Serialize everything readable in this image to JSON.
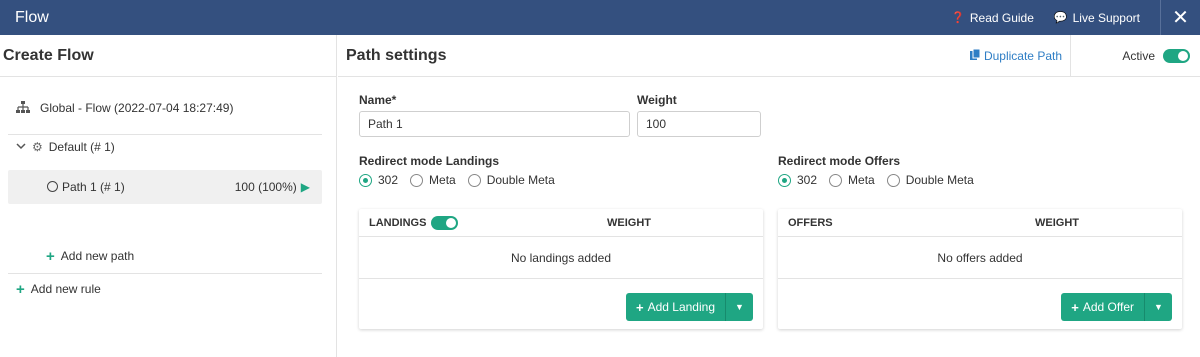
{
  "topbar": {
    "title": "Flow",
    "read_guide": "Read Guide",
    "live_support": "Live Support",
    "close": "✕"
  },
  "left": {
    "title": "Create Flow",
    "global": "Global - Flow (2022-07-04 18:27:49)",
    "default_rule": "Default (# 1)",
    "path_label": "Path 1 (# 1)",
    "path_value": "100 (100%)",
    "add_path": "Add new path",
    "add_rule": "Add new rule"
  },
  "main": {
    "title": "Path settings",
    "duplicate": "Duplicate Path",
    "active_label": "Active",
    "active": true,
    "name_label": "Name*",
    "name_value": "Path 1",
    "weight_label": "Weight",
    "weight_value": "100",
    "redirect_landings_label": "Redirect mode Landings",
    "redirect_offers_label": "Redirect mode Offers",
    "redirect_options": [
      "302",
      "Meta",
      "Double Meta"
    ],
    "redirect_landings_selected": "302",
    "redirect_offers_selected": "302",
    "landings": {
      "header": "LANDINGS",
      "weight_header": "WEIGHT",
      "empty": "No landings added",
      "add_button": "Add Landing",
      "enabled": true
    },
    "offers": {
      "header": "OFFERS",
      "weight_header": "WEIGHT",
      "empty": "No offers added",
      "add_button": "Add Offer"
    }
  },
  "colors": {
    "topbar": "#34507f",
    "accent": "#1fa683",
    "link": "#2f7ec5"
  }
}
